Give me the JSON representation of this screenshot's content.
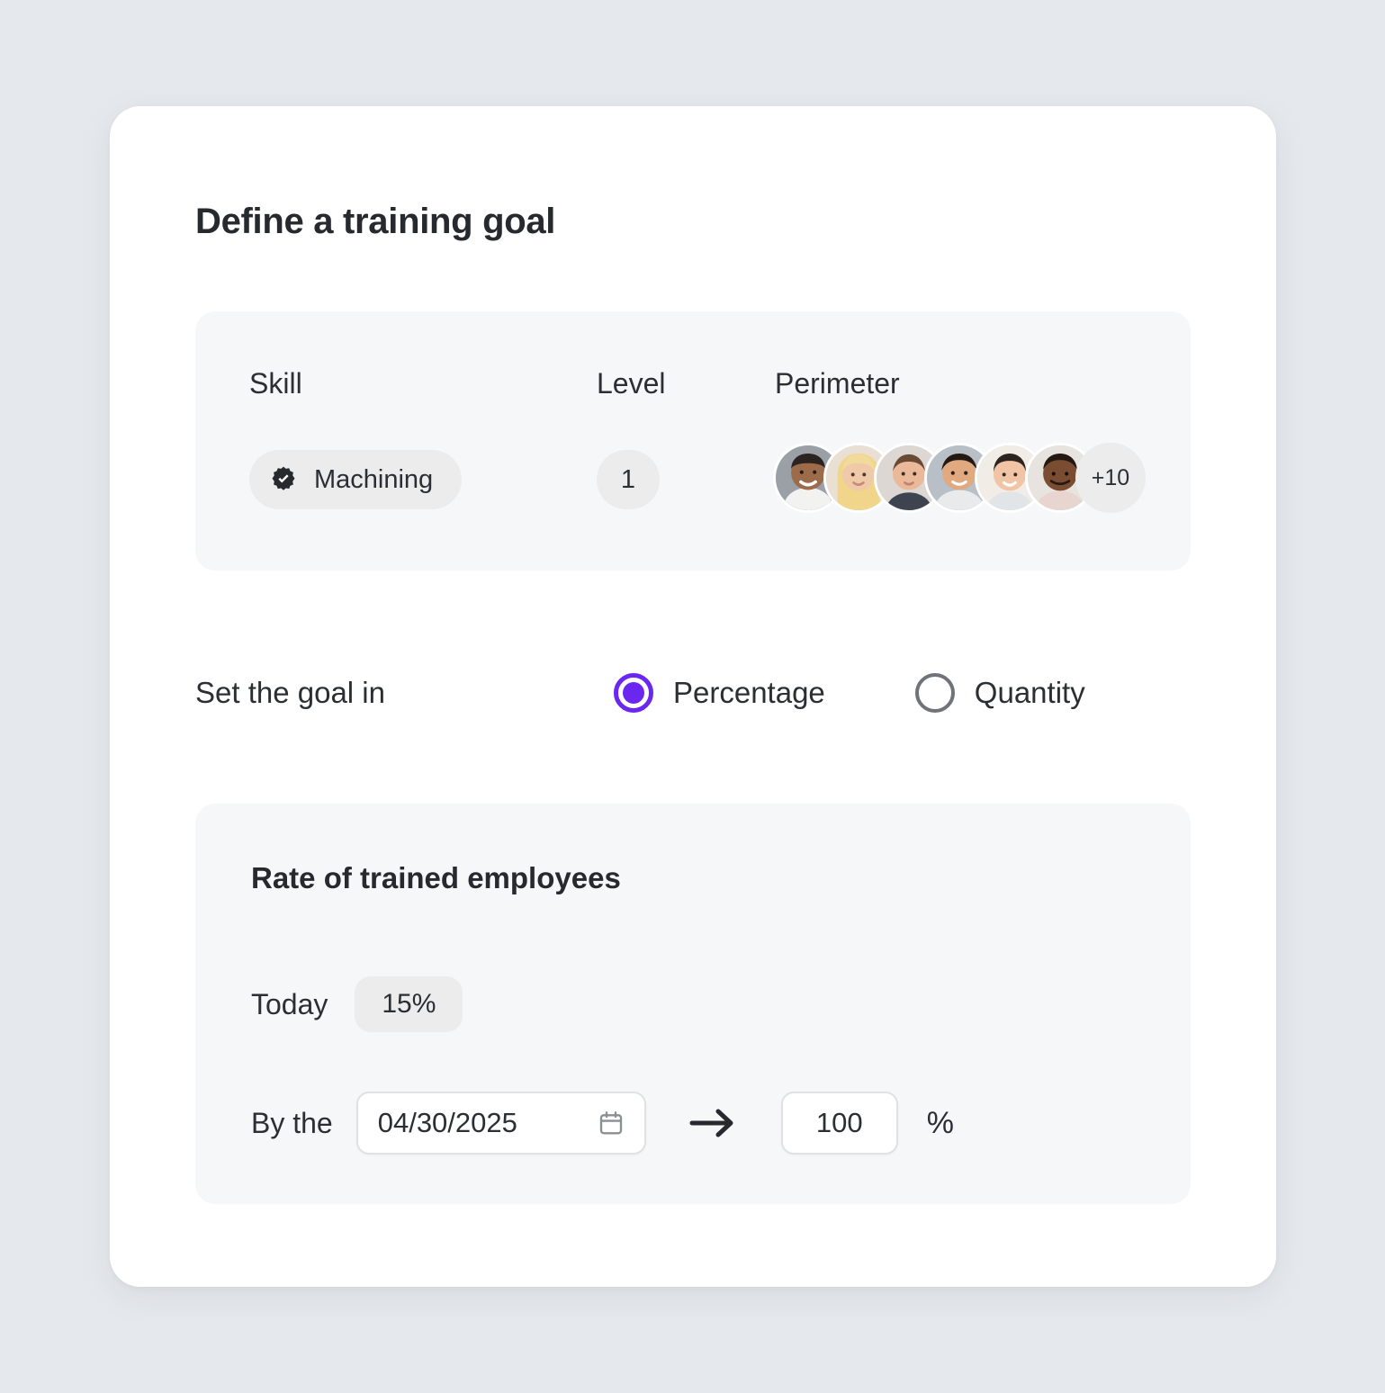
{
  "card": {
    "title": "Define a training goal"
  },
  "attributes": {
    "columns": {
      "skill": "Skill",
      "level": "Level",
      "perimeter": "Perimeter"
    },
    "skill": {
      "icon": "badge-check-icon",
      "value": "Machining"
    },
    "level": {
      "value": "1"
    },
    "perimeter": {
      "avatar_count": 6,
      "overflow_label": "+10"
    }
  },
  "goal_type": {
    "prompt": "Set the goal in",
    "options": [
      {
        "label": "Percentage",
        "selected": true
      },
      {
        "label": "Quantity",
        "selected": false
      }
    ],
    "selected_color": "#6b26f0",
    "unselected_color": "#70747a"
  },
  "metric": {
    "title": "Rate of trained employees",
    "today": {
      "label": "Today",
      "value": "15%"
    },
    "target": {
      "label": "By the",
      "date": "04/30/2025",
      "date_icon": "calendar-icon",
      "arrow_icon": "arrow-right-icon",
      "value": "100",
      "unit": "%"
    }
  }
}
